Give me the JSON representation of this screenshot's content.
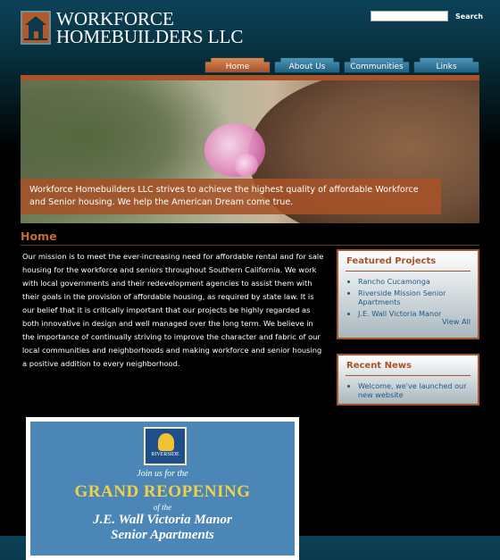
{
  "header": {
    "logo_line1": "WORKFORCE",
    "logo_line2": "HOMEBUILDERS LLC",
    "search_placeholder": "",
    "search_button": "Search"
  },
  "nav": {
    "tabs": [
      {
        "label": "Home",
        "active": true
      },
      {
        "label": "About Us",
        "active": false
      },
      {
        "label": "Communities",
        "active": false
      },
      {
        "label": "Links",
        "active": false
      }
    ]
  },
  "hero": {
    "caption": "Workforce Homebuilders LLC strives to achieve the highest quality of affordable Workforce and Senior housing. We help the American Dream come true."
  },
  "main": {
    "title": "Home",
    "mission": "Our mission is to meet the ever-increasing need for affordable rental and for sale housing for the workforce and seniors throughout Southern California. We work with local governments and their redevelopment agencies to assist them with their goals in the provision of affordable housing, as required by state law. It is our belief that it is critically important that our projects be highly regarded as both innovative in design and well managed over the long term. We believe in the importance of continually striving to improve the character and fabric of our local communities and neighborhoods and making workforce and senior housing a positive addition to every neighborhood."
  },
  "featured": {
    "title": "Featured Projects",
    "items": [
      "Rancho Cucamonga",
      "Riverside Mission Senior Apartments",
      "J.E. Wall Victoria Manor"
    ],
    "view_all": "View All"
  },
  "news": {
    "title": "Recent News",
    "items": [
      "Welcome, we've launched our new website"
    ]
  },
  "flyer": {
    "seal_text": "RIVERSIDE",
    "invite": "Join us for the",
    "headline": "GRAND REOPENING",
    "of_the": "of the",
    "manor": "J.E. Wall Victoria Manor",
    "senior": "Senior Apartments"
  },
  "colors": {
    "accent_orange": "#a9532a",
    "nav_blue": "#2a6f90",
    "link_blue": "#1d5a8a",
    "flyer_blue": "#4c86b6",
    "flyer_gold": "#f1d04a"
  }
}
